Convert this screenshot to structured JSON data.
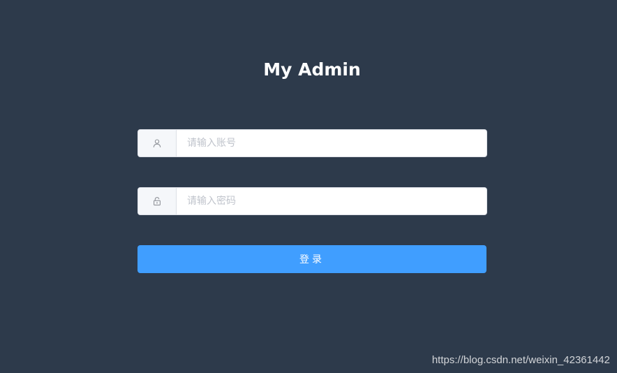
{
  "app": {
    "title": "My Admin"
  },
  "form": {
    "account": {
      "placeholder": "请输入账号",
      "value": "",
      "icon": "user-icon"
    },
    "password": {
      "placeholder": "请输入密码",
      "value": "",
      "icon": "lock-icon"
    },
    "login_label": "登录"
  },
  "colors": {
    "background": "#2d3a4b",
    "primary": "#409eff",
    "input_border": "#dcdfe6",
    "prepend_bg": "#f5f7fa",
    "placeholder": "#c0c4cc",
    "icon": "#909399"
  },
  "watermark": "https://blog.csdn.net/weixin_42361442"
}
